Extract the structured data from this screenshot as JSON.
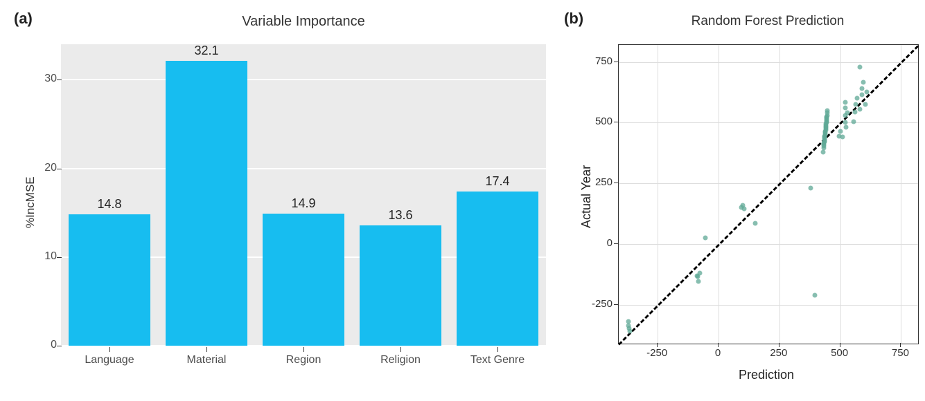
{
  "panel_a_label": "(a)",
  "panel_b_label": "(b)",
  "chart_data": [
    {
      "id": "a",
      "type": "bar",
      "title": "Variable Importance",
      "ylabel": "%IncMSE",
      "xlabel": "",
      "ylim": [
        0,
        34
      ],
      "yticks": [
        0,
        10,
        20,
        30
      ],
      "categories": [
        "Language",
        "Material",
        "Region",
        "Religion",
        "Text Genre"
      ],
      "values": [
        14.8,
        32.1,
        14.9,
        13.6,
        17.4
      ],
      "bar_color": "#17bdf0",
      "panel_bg": "#ebebeb"
    },
    {
      "id": "b",
      "type": "scatter",
      "title": "Random Forest Prediction",
      "xlabel": "Prediction",
      "ylabel": "Actual Year",
      "xlim": [
        -410,
        820
      ],
      "ylim": [
        -410,
        820
      ],
      "xticks": [
        -250,
        0,
        250,
        500,
        750
      ],
      "yticks": [
        -250,
        0,
        250,
        500,
        750
      ],
      "reference_line": {
        "slope": 1,
        "intercept": 0,
        "style": "dashed",
        "color": "#000"
      },
      "point_color": "#5fa895",
      "points": [
        {
          "x": -370,
          "y": -320
        },
        {
          "x": -370,
          "y": -335
        },
        {
          "x": -368,
          "y": -348
        },
        {
          "x": -365,
          "y": -360
        },
        {
          "x": -88,
          "y": -130
        },
        {
          "x": -85,
          "y": -135
        },
        {
          "x": -82,
          "y": -155
        },
        {
          "x": -78,
          "y": -120
        },
        {
          "x": -55,
          "y": 25
        },
        {
          "x": 95,
          "y": 150
        },
        {
          "x": 105,
          "y": 145
        },
        {
          "x": 100,
          "y": 160
        },
        {
          "x": 150,
          "y": 85
        },
        {
          "x": 395,
          "y": -210
        },
        {
          "x": 380,
          "y": 230
        },
        {
          "x": 430,
          "y": 380
        },
        {
          "x": 432,
          "y": 395
        },
        {
          "x": 433,
          "y": 405
        },
        {
          "x": 434,
          "y": 410
        },
        {
          "x": 434,
          "y": 415
        },
        {
          "x": 435,
          "y": 420
        },
        {
          "x": 435,
          "y": 425
        },
        {
          "x": 436,
          "y": 430
        },
        {
          "x": 436,
          "y": 435
        },
        {
          "x": 437,
          "y": 440
        },
        {
          "x": 437,
          "y": 445
        },
        {
          "x": 438,
          "y": 450
        },
        {
          "x": 438,
          "y": 455
        },
        {
          "x": 439,
          "y": 460
        },
        {
          "x": 439,
          "y": 465
        },
        {
          "x": 440,
          "y": 470
        },
        {
          "x": 440,
          "y": 475
        },
        {
          "x": 441,
          "y": 480
        },
        {
          "x": 441,
          "y": 485
        },
        {
          "x": 442,
          "y": 490
        },
        {
          "x": 442,
          "y": 495
        },
        {
          "x": 443,
          "y": 500
        },
        {
          "x": 443,
          "y": 505
        },
        {
          "x": 444,
          "y": 510
        },
        {
          "x": 444,
          "y": 515
        },
        {
          "x": 445,
          "y": 520
        },
        {
          "x": 445,
          "y": 525
        },
        {
          "x": 446,
          "y": 530
        },
        {
          "x": 446,
          "y": 540
        },
        {
          "x": 447,
          "y": 550
        },
        {
          "x": 495,
          "y": 445
        },
        {
          "x": 500,
          "y": 465
        },
        {
          "x": 510,
          "y": 440
        },
        {
          "x": 520,
          "y": 500
        },
        {
          "x": 520,
          "y": 530
        },
        {
          "x": 520,
          "y": 560
        },
        {
          "x": 520,
          "y": 585
        },
        {
          "x": 525,
          "y": 480
        },
        {
          "x": 530,
          "y": 540
        },
        {
          "x": 555,
          "y": 505
        },
        {
          "x": 560,
          "y": 545
        },
        {
          "x": 565,
          "y": 575
        },
        {
          "x": 570,
          "y": 600
        },
        {
          "x": 580,
          "y": 555
        },
        {
          "x": 590,
          "y": 615
        },
        {
          "x": 590,
          "y": 640
        },
        {
          "x": 595,
          "y": 665
        },
        {
          "x": 605,
          "y": 575
        },
        {
          "x": 610,
          "y": 625
        },
        {
          "x": 580,
          "y": 730
        }
      ]
    }
  ]
}
